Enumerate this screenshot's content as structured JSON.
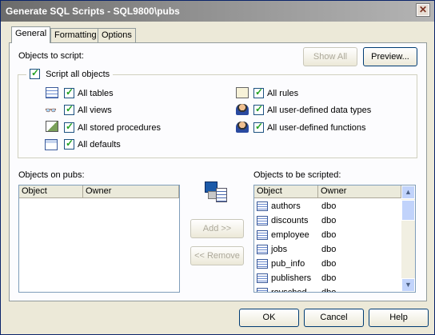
{
  "window": {
    "title": "Generate SQL Scripts - SQL9800\\pubs"
  },
  "tabs": [
    {
      "label": "General",
      "active": true
    },
    {
      "label": "Formatting",
      "active": false
    },
    {
      "label": "Options",
      "active": false
    }
  ],
  "objects_to_script_label": "Objects to script:",
  "show_all_label": "Show All",
  "preview_label": "Preview...",
  "script_all_label": "Script all objects",
  "options_left": [
    {
      "label": "All tables",
      "icon": "table-icon",
      "checked": true
    },
    {
      "label": "All views",
      "icon": "view-icon",
      "checked": true
    },
    {
      "label": "All stored procedures",
      "icon": "stored-procedure-icon",
      "checked": true
    },
    {
      "label": "All defaults",
      "icon": "default-icon",
      "checked": true
    }
  ],
  "options_right": [
    {
      "label": "All rules",
      "icon": "rule-icon",
      "checked": true
    },
    {
      "label": "All user-defined data types",
      "icon": "user-type-icon",
      "checked": true
    },
    {
      "label": "All user-defined functions",
      "icon": "user-function-icon",
      "checked": true
    }
  ],
  "objects_on_label": "Objects on pubs:",
  "objects_scripted_label": "Objects to be scripted:",
  "columns": {
    "object": "Object",
    "owner": "Owner"
  },
  "left_list": [],
  "scripted_list": [
    {
      "object": "authors",
      "owner": "dbo"
    },
    {
      "object": "discounts",
      "owner": "dbo"
    },
    {
      "object": "employee",
      "owner": "dbo"
    },
    {
      "object": "jobs",
      "owner": "dbo"
    },
    {
      "object": "pub_info",
      "owner": "dbo"
    },
    {
      "object": "publishers",
      "owner": "dbo"
    },
    {
      "object": "roysched",
      "owner": "dbo"
    }
  ],
  "add_label": "Add >>",
  "remove_label": "<< Remove",
  "ok_label": "OK",
  "cancel_label": "Cancel",
  "help_label": "Help"
}
